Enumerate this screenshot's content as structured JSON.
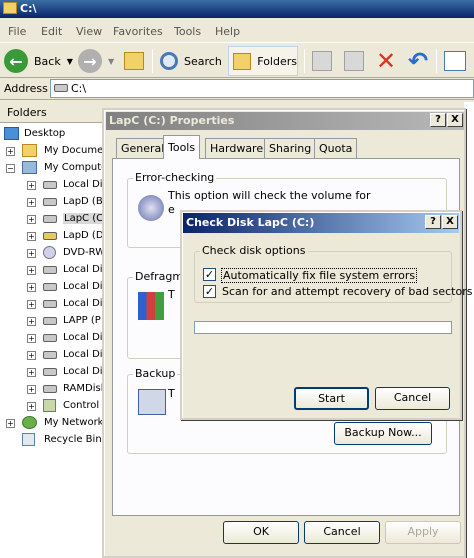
{
  "window": {
    "title": "C:\\"
  },
  "menu": [
    "File",
    "Edit",
    "View",
    "Favorites",
    "Tools",
    "Help"
  ],
  "toolbar": {
    "back": "Back",
    "search": "Search",
    "folders": "Folders"
  },
  "address": {
    "label": "Address",
    "value": "C:\\"
  },
  "folders": {
    "header": "Folders",
    "items": [
      "Desktop",
      "My Documer",
      "My Compute",
      "Local Dis",
      "LapD (B",
      "LapC (C",
      "LapD (D",
      "DVD-RW",
      "Local Dis",
      "Local Dis",
      "Local Dis",
      "LAPP (P",
      "Local Dis",
      "Local Dis",
      "Local Dis",
      "RAMDisk",
      "Control",
      "My Network",
      "Recycle Bin"
    ]
  },
  "properties": {
    "title": "LapC (C:) Properties",
    "help": "?",
    "close": "X",
    "tabs": [
      "General",
      "Tools",
      "Hardware",
      "Sharing",
      "Quota"
    ],
    "error_checking": {
      "label": "Error-checking",
      "text": "This option will check the volume for",
      "text2": "e"
    },
    "defrag": {
      "label": "Defragme",
      "text": "T"
    },
    "backup": {
      "label": "Backup",
      "text": "T",
      "button": "Backup Now..."
    },
    "buttons": {
      "ok": "OK",
      "cancel": "Cancel",
      "apply": "Apply"
    }
  },
  "checkdisk": {
    "title": "Check Disk LapC (C:)",
    "help": "?",
    "close": "X",
    "group_label": "Check disk options",
    "option1": "Automatically fix file system errors",
    "option2": "Scan for and attempt recovery of bad sectors",
    "option1_checked": true,
    "option2_checked": true,
    "start": "Start",
    "cancel": "Cancel"
  },
  "colors": {
    "title_active": "#0a246a",
    "title_inactive": "#808080",
    "close_red": "#e0301e"
  }
}
